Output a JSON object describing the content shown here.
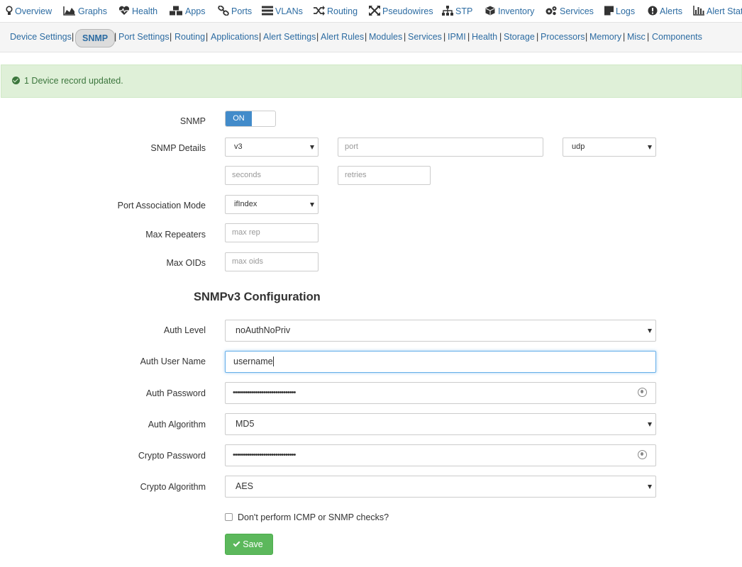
{
  "topnav": [
    {
      "label": "Overview",
      "icon": "lightbulb-icon"
    },
    {
      "label": "Graphs",
      "icon": "area-chart-icon"
    },
    {
      "label": "Health",
      "icon": "heartbeat-icon"
    },
    {
      "label": "Apps",
      "icon": "cubes-icon"
    },
    {
      "label": "Ports",
      "icon": "link-icon"
    },
    {
      "label": "VLANs",
      "icon": "tasks-icon"
    },
    {
      "label": "Routing",
      "icon": "random-icon"
    },
    {
      "label": "Pseudowires",
      "icon": "arrows-icon"
    },
    {
      "label": "STP",
      "icon": "sitemap-icon"
    },
    {
      "label": "Inventory",
      "icon": "cube-icon"
    },
    {
      "label": "Services",
      "icon": "cogs-icon"
    },
    {
      "label": "Logs",
      "icon": "sticky-note-icon"
    },
    {
      "label": "Alerts",
      "icon": "exclamation-circle-icon"
    },
    {
      "label": "Alert Stat",
      "icon": "bar-chart-icon"
    }
  ],
  "subnav": {
    "items": [
      "Device Settings",
      "SNMP",
      "Port Settings",
      "Routing",
      "Applications",
      "Alert Settings",
      "Alert Rules",
      "Modules",
      "Services",
      "IPMI",
      "Health",
      "Storage",
      "Processors",
      "Memory",
      "Misc",
      "Components"
    ],
    "active": "SNMP"
  },
  "alert": {
    "message": "1 Device record updated.",
    "color": "#dff0d8"
  },
  "form": {
    "snmp_label": "SNMP",
    "snmp_toggle": "ON",
    "snmp_details_label": "SNMP Details",
    "snmp_version": "v3",
    "port_placeholder": "port",
    "transport": "udp",
    "timeout_placeholder": "seconds",
    "retries_placeholder": "retries",
    "port_assoc_label": "Port Association Mode",
    "port_assoc_value": "ifIndex",
    "max_rep_label": "Max Repeaters",
    "max_rep_placeholder": "max rep",
    "max_oids_label": "Max OIDs",
    "max_oids_placeholder": "max oids",
    "v3_heading": "SNMPv3 Configuration",
    "auth_level_label": "Auth Level",
    "auth_level_value": "noAuthNoPriv",
    "auth_user_label": "Auth User Name",
    "auth_user_value": "username",
    "auth_pass_label": "Auth Password",
    "auth_pass_value": "•••••••••••••••••••••••••••••••",
    "auth_algo_label": "Auth Algorithm",
    "auth_algo_value": "MD5",
    "crypto_pass_label": "Crypto Password",
    "crypto_pass_value": "•••••••••••••••••••••••••••••••",
    "crypto_algo_label": "Crypto Algorithm",
    "crypto_algo_value": "AES",
    "disable_checks_label": "Don't perform ICMP or SNMP checks?",
    "save_label": "Save"
  },
  "colors": {
    "link": "#2d6ca2",
    "primary": "#428bca",
    "success": "#5cb85c"
  }
}
